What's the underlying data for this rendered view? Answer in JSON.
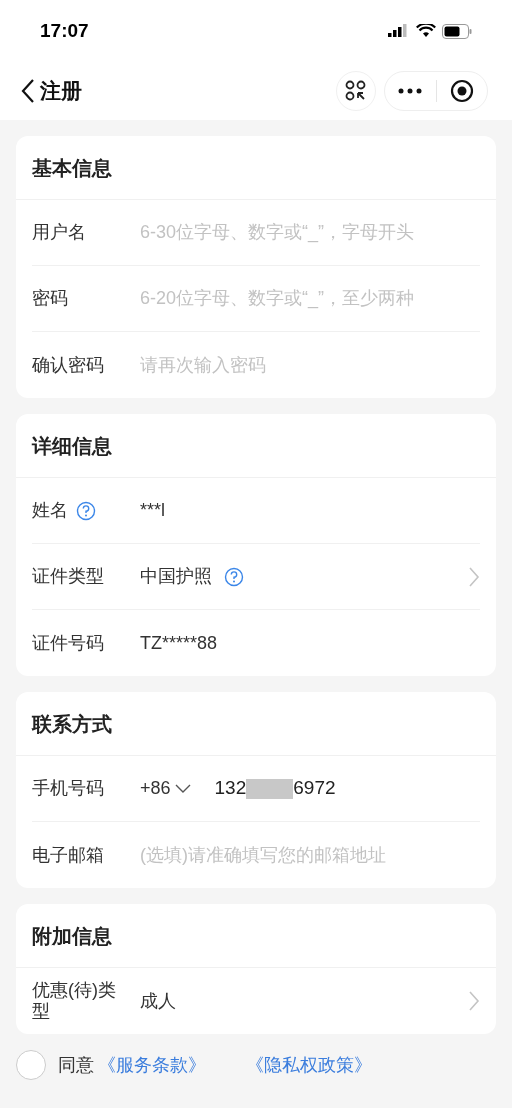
{
  "status_bar": {
    "time": "17:07"
  },
  "nav": {
    "title": "注册"
  },
  "sections": [
    {
      "title": "基本信息",
      "rows": [
        {
          "kind": "input",
          "label": "用户名",
          "placeholder": "6-30位字母、数字或“_”，字母开头"
        },
        {
          "kind": "input",
          "label": "密码",
          "placeholder": "6-20位字母、数字或“_”，至少两种"
        },
        {
          "kind": "input",
          "label": "确认密码",
          "placeholder": "请再次输入密码"
        }
      ]
    },
    {
      "title": "详细信息",
      "rows": [
        {
          "kind": "value",
          "label": "姓名",
          "value": "***l",
          "label_help": true,
          "value_help": false,
          "chevron": false
        },
        {
          "kind": "value",
          "label": "证件类型",
          "value": "中国护照",
          "label_help": false,
          "value_help": true,
          "chevron": true
        },
        {
          "kind": "value",
          "label": "证件号码",
          "value": "TZ*****88",
          "label_help": false,
          "value_help": false,
          "chevron": false
        }
      ]
    },
    {
      "title": "联系方式",
      "rows": [
        {
          "kind": "phone",
          "label": "手机号码",
          "prefix": "+86",
          "start": "132",
          "end": "6972"
        },
        {
          "kind": "input",
          "label": "电子邮箱",
          "placeholder": "(选填)请准确填写您的邮箱地址"
        }
      ]
    },
    {
      "title": "附加信息",
      "rows": [
        {
          "kind": "value",
          "label": "优惠(待)类型",
          "value": "成人",
          "label_help": false,
          "value_help": false,
          "chevron": true
        }
      ]
    }
  ],
  "agreement": {
    "checked": false,
    "text": "同意",
    "links": [
      "《服务条款》",
      "《隐私权政策》"
    ]
  }
}
